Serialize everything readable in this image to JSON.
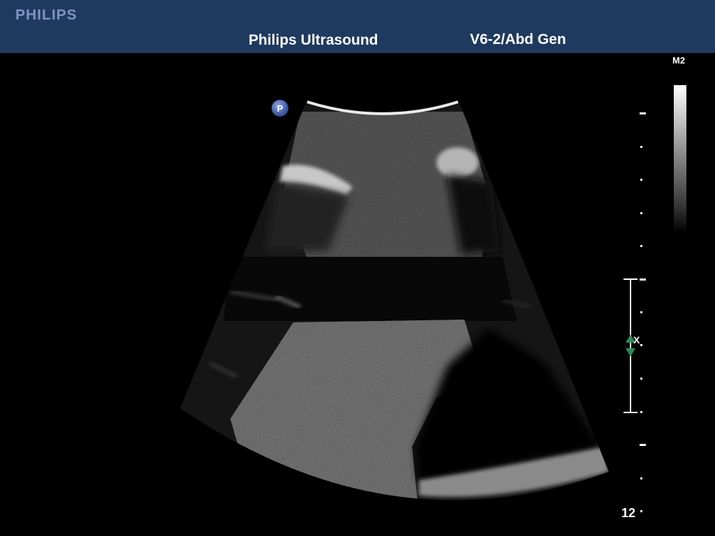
{
  "header": {
    "brand": "PHILIPS",
    "app_title": "Philips Ultrasound",
    "probe_preset": "V6-2/Abd Gen"
  },
  "grayscale_map": {
    "label": "M2"
  },
  "probe_marker": {
    "label": "P"
  },
  "focal_zone": {
    "marker": "X"
  },
  "depth": {
    "value": "12"
  },
  "colors": {
    "header_bg": "#1f3a5f",
    "brand": "#7f93c4",
    "focal_arrow": "#2e8b57",
    "probe_marker": "#3f5aa3"
  },
  "icons": [
    "probe-orientation-icon",
    "focal-up-arrow-icon",
    "focal-down-arrow-icon"
  ]
}
